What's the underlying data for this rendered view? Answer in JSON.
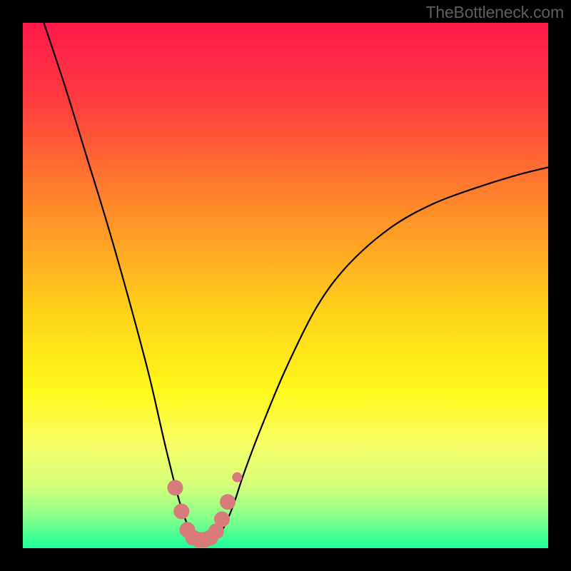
{
  "watermark": "TheBottleneck.com",
  "chart_data": {
    "type": "line",
    "title": "",
    "xlabel": "",
    "ylabel": "",
    "xlim": [
      0,
      100
    ],
    "ylim": [
      0,
      100
    ],
    "gradient_stops": [
      {
        "offset": 0.0,
        "color": "#ff1a4a"
      },
      {
        "offset": 0.15,
        "color": "#ff3c3f"
      },
      {
        "offset": 0.35,
        "color": "#ff8a2a"
      },
      {
        "offset": 0.55,
        "color": "#ffd21a"
      },
      {
        "offset": 0.7,
        "color": "#fff81a"
      },
      {
        "offset": 0.8,
        "color": "#f8ff66"
      },
      {
        "offset": 0.88,
        "color": "#d6ff7a"
      },
      {
        "offset": 0.94,
        "color": "#8aff8a"
      },
      {
        "offset": 1.0,
        "color": "#1aff9a"
      }
    ],
    "series": [
      {
        "name": "bottleneck-curve",
        "x": [
          4,
          8,
          12,
          16,
          20,
          24,
          27,
          29.5,
          31.5,
          33,
          34.5,
          36,
          38,
          40,
          42,
          45,
          50,
          56,
          62,
          70,
          78,
          86,
          94,
          100
        ],
        "y": [
          100,
          88,
          75,
          62,
          48,
          33,
          20,
          10,
          4,
          1.5,
          1.2,
          1.5,
          3.5,
          8,
          14,
          22,
          34,
          46,
          54,
          61,
          65.5,
          68.5,
          71,
          72.5
        ]
      }
    ],
    "marker_series": {
      "name": "optimal-range",
      "color": "#d97b7b",
      "size_large": 11,
      "size_small": 7,
      "points": [
        {
          "x": 29.0,
          "y": 11.5,
          "s": 11
        },
        {
          "x": 30.2,
          "y": 7.0,
          "s": 11
        },
        {
          "x": 31.3,
          "y": 3.5,
          "s": 11
        },
        {
          "x": 32.4,
          "y": 2.0,
          "s": 11
        },
        {
          "x": 33.5,
          "y": 1.6,
          "s": 11
        },
        {
          "x": 34.6,
          "y": 1.6,
          "s": 11
        },
        {
          "x": 35.7,
          "y": 2.0,
          "s": 11
        },
        {
          "x": 36.8,
          "y": 3.2,
          "s": 11
        },
        {
          "x": 37.9,
          "y": 5.5,
          "s": 11
        },
        {
          "x": 39.0,
          "y": 8.8,
          "s": 11
        },
        {
          "x": 40.8,
          "y": 13.5,
          "s": 7
        }
      ]
    }
  }
}
